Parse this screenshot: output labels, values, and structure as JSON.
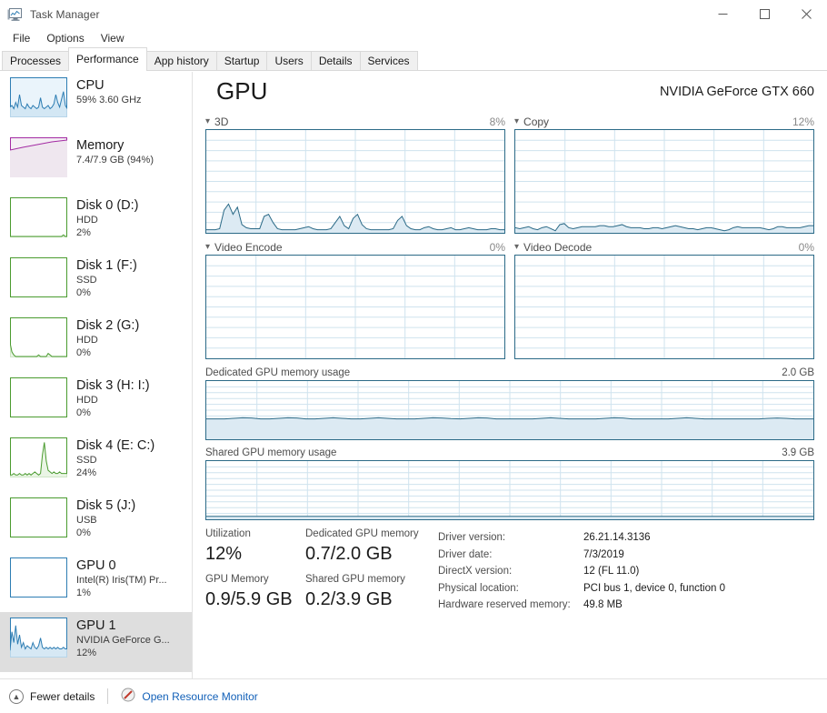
{
  "window": {
    "title": "Task Manager",
    "icon": "task-manager-icon",
    "minimize": "─",
    "maximize": "□",
    "close": "✕"
  },
  "menu": {
    "items": [
      "File",
      "Options",
      "View"
    ]
  },
  "tabs": [
    {
      "label": "Processes",
      "active": false
    },
    {
      "label": "Performance",
      "active": true
    },
    {
      "label": "App history",
      "active": false
    },
    {
      "label": "Startup",
      "active": false
    },
    {
      "label": "Users",
      "active": false
    },
    {
      "label": "Details",
      "active": false
    },
    {
      "label": "Services",
      "active": false
    }
  ],
  "sidebar": {
    "items": [
      {
        "title": "CPU",
        "sub1": "59%  3.60 GHz",
        "sub2": "",
        "color": "#2d7db3",
        "fill": "#cfe4f2",
        "selected": false,
        "graph": "cpu"
      },
      {
        "title": "Memory",
        "sub1": "7.4/7.9 GB (94%)",
        "sub2": "",
        "color": "#a32ba3",
        "fill": "#f0e6f0",
        "selected": false,
        "graph": "memory"
      },
      {
        "title": "Disk 0 (D:)",
        "sub1": "HDD",
        "sub2": "2%",
        "color": "#4a9b2f",
        "fill": "#e6f3e0",
        "selected": false,
        "graph": "flat"
      },
      {
        "title": "Disk 1 (F:)",
        "sub1": "SSD",
        "sub2": "0%",
        "color": "#4a9b2f",
        "fill": "#e6f3e0",
        "selected": false,
        "graph": "empty"
      },
      {
        "title": "Disk 2 (G:)",
        "sub1": "HDD",
        "sub2": "0%",
        "color": "#4a9b2f",
        "fill": "#e6f3e0",
        "selected": false,
        "graph": "lowspike"
      },
      {
        "title": "Disk 3 (H: I:)",
        "sub1": "HDD",
        "sub2": "0%",
        "color": "#4a9b2f",
        "fill": "#e6f3e0",
        "selected": false,
        "graph": "empty"
      },
      {
        "title": "Disk 4 (E: C:)",
        "sub1": "SSD",
        "sub2": "24%",
        "color": "#4a9b2f",
        "fill": "#e6f3e0",
        "selected": false,
        "graph": "spike"
      },
      {
        "title": "Disk 5 (J:)",
        "sub1": "USB",
        "sub2": "0%",
        "color": "#4a9b2f",
        "fill": "#e6f3e0",
        "selected": false,
        "graph": "empty"
      },
      {
        "title": "GPU 0",
        "sub1": "Intel(R) Iris(TM) Pr...",
        "sub2": "1%",
        "color": "#2d7db3",
        "fill": "#cfe4f2",
        "selected": false,
        "graph": "empty"
      },
      {
        "title": "GPU 1",
        "sub1": "NVIDIA GeForce G...",
        "sub2": "12%",
        "color": "#2d7db3",
        "fill": "#cfe4f2",
        "selected": true,
        "graph": "gpu"
      }
    ]
  },
  "main": {
    "title": "GPU",
    "device": "NVIDIA GeForce GTX 660",
    "graphs": [
      {
        "label": "3D",
        "percent": "8%"
      },
      {
        "label": "Copy",
        "percent": "12%"
      },
      {
        "label": "Video Encode",
        "percent": "0%"
      },
      {
        "label": "Video Decode",
        "percent": "0%"
      }
    ],
    "memory_graphs": [
      {
        "label": "Dedicated GPU memory usage",
        "capacity": "2.0 GB"
      },
      {
        "label": "Shared GPU memory usage",
        "capacity": "3.9 GB"
      }
    ],
    "stats": [
      {
        "label": "Utilization",
        "value": "12%"
      },
      {
        "label": "Dedicated GPU memory",
        "value": "0.7/2.0 GB"
      },
      {
        "label": "GPU Memory",
        "value": "0.9/5.9 GB"
      },
      {
        "label": "Shared GPU memory",
        "value": "0.2/3.9 GB"
      }
    ],
    "info": [
      {
        "key": "Driver version:",
        "value": "26.21.14.3136"
      },
      {
        "key": "Driver date:",
        "value": "7/3/2019"
      },
      {
        "key": "DirectX version:",
        "value": "12 (FL 11.0)"
      },
      {
        "key": "Physical location:",
        "value": "PCI bus 1, device 0, function 0"
      },
      {
        "key": "Hardware reserved memory:",
        "value": "49.8 MB"
      }
    ]
  },
  "statusbar": {
    "fewer_details": "Fewer details",
    "fewer_details_icon": "chevron-up-icon",
    "resource_monitor": "Open Resource Monitor",
    "resource_monitor_icon": "resource-monitor-icon"
  },
  "colors": {
    "gpu_line": "#2b6a87",
    "gpu_fill": "#dceaf3",
    "accent_link": "#1260b8",
    "selection": "#dedede"
  },
  "chart_data": {
    "type": "area",
    "title": "GPU",
    "ylim": [
      0,
      100
    ],
    "grid": true,
    "charts": [
      {
        "name": "3D",
        "ylabel": "%",
        "max_label": "8%",
        "values": [
          3,
          3,
          3,
          4,
          22,
          28,
          18,
          25,
          8,
          5,
          4,
          4,
          4,
          16,
          18,
          10,
          4,
          3,
          3,
          3,
          3,
          4,
          5,
          6,
          4,
          3,
          3,
          3,
          4,
          10,
          16,
          7,
          4,
          14,
          18,
          8,
          4,
          3,
          3,
          3,
          3,
          3,
          4,
          12,
          16,
          7,
          4,
          3,
          3,
          5,
          6,
          4,
          3,
          3,
          4,
          5,
          3,
          3,
          4,
          5,
          4,
          3,
          3,
          3,
          4,
          4,
          3,
          3
        ]
      },
      {
        "name": "Copy",
        "ylabel": "%",
        "max_label": "12%",
        "values": [
          5,
          4,
          5,
          6,
          4,
          3,
          5,
          6,
          4,
          2,
          8,
          9,
          5,
          4,
          5,
          6,
          6,
          6,
          6,
          7,
          7,
          6,
          6,
          7,
          8,
          6,
          5,
          5,
          5,
          4,
          4,
          5,
          5,
          4,
          5,
          6,
          7,
          6,
          5,
          4,
          4,
          3,
          4,
          5,
          5,
          4,
          3,
          2,
          3,
          5,
          6,
          5,
          5,
          5,
          5,
          5,
          4,
          3,
          4,
          6,
          6,
          5,
          5,
          5,
          5,
          6,
          7,
          7
        ]
      },
      {
        "name": "Video Encode",
        "ylabel": "%",
        "max_label": "0%",
        "values": [
          0,
          0,
          0,
          0,
          0,
          0,
          0,
          0,
          0,
          0,
          0,
          0,
          0,
          0,
          0,
          0,
          0,
          0,
          0,
          0,
          0,
          0,
          0,
          0,
          0,
          0,
          0,
          0,
          0,
          0,
          0,
          0,
          0,
          0,
          0,
          0,
          0,
          0,
          0,
          0,
          0,
          0,
          0,
          0,
          0,
          0,
          0,
          0,
          0,
          0,
          0,
          0,
          0,
          0,
          0,
          0,
          0,
          0,
          0,
          0,
          0,
          0,
          0,
          0,
          0,
          0,
          0,
          0
        ]
      },
      {
        "name": "Video Decode",
        "ylabel": "%",
        "max_label": "0%",
        "values": [
          0,
          0,
          0,
          0,
          0,
          0,
          0,
          0,
          0,
          0,
          0,
          0,
          0,
          0,
          0,
          0,
          0,
          0,
          0,
          0,
          0,
          0,
          0,
          0,
          0,
          0,
          0,
          0,
          0,
          0,
          0,
          0,
          0,
          0,
          0,
          0,
          0,
          0,
          0,
          0,
          0,
          0,
          0,
          0,
          0,
          0,
          0,
          0,
          0,
          0,
          0,
          0,
          0,
          0,
          0,
          0,
          0,
          0,
          0,
          0,
          0,
          0,
          0,
          0,
          0,
          0,
          0,
          0
        ]
      },
      {
        "name": "Dedicated GPU memory usage",
        "ylabel": "GB",
        "max_label": "2.0 GB",
        "ylim": [
          0,
          2.0
        ],
        "values": [
          0.7,
          0.7,
          0.7,
          0.72,
          0.74,
          0.73,
          0.7,
          0.7,
          0.72,
          0.74,
          0.73,
          0.7,
          0.7,
          0.72,
          0.74,
          0.72,
          0.7,
          0.7,
          0.72,
          0.74,
          0.72,
          0.7,
          0.7,
          0.7,
          0.72,
          0.74,
          0.73,
          0.71,
          0.7,
          0.72,
          0.74,
          0.73,
          0.7,
          0.7,
          0.7,
          0.7,
          0.7,
          0.72,
          0.74,
          0.72,
          0.7,
          0.7,
          0.7,
          0.7,
          0.72,
          0.74,
          0.73,
          0.7,
          0.7,
          0.7,
          0.7,
          0.7,
          0.72,
          0.74,
          0.72,
          0.7,
          0.7,
          0.7,
          0.7,
          0.7,
          0.7,
          0.7,
          0.72,
          0.73,
          0.72,
          0.7,
          0.7,
          0.7
        ]
      },
      {
        "name": "Shared GPU memory usage",
        "ylabel": "GB",
        "max_label": "3.9 GB",
        "ylim": [
          0,
          3.9
        ],
        "values": [
          0.2,
          0.2,
          0.2,
          0.2,
          0.2,
          0.2,
          0.2,
          0.2,
          0.2,
          0.2,
          0.2,
          0.2,
          0.2,
          0.2,
          0.2,
          0.2,
          0.2,
          0.2,
          0.2,
          0.2,
          0.2,
          0.2,
          0.2,
          0.2,
          0.2,
          0.2,
          0.2,
          0.2,
          0.2,
          0.2,
          0.2,
          0.2,
          0.2,
          0.2,
          0.2,
          0.2,
          0.2,
          0.2,
          0.2,
          0.2,
          0.2,
          0.2,
          0.2,
          0.2,
          0.2,
          0.2,
          0.2,
          0.2,
          0.2,
          0.2,
          0.2,
          0.2,
          0.2,
          0.2,
          0.2,
          0.2,
          0.2,
          0.2,
          0.2,
          0.2,
          0.2,
          0.2,
          0.2,
          0.2,
          0.2,
          0.2,
          0.2,
          0.2
        ]
      }
    ]
  }
}
